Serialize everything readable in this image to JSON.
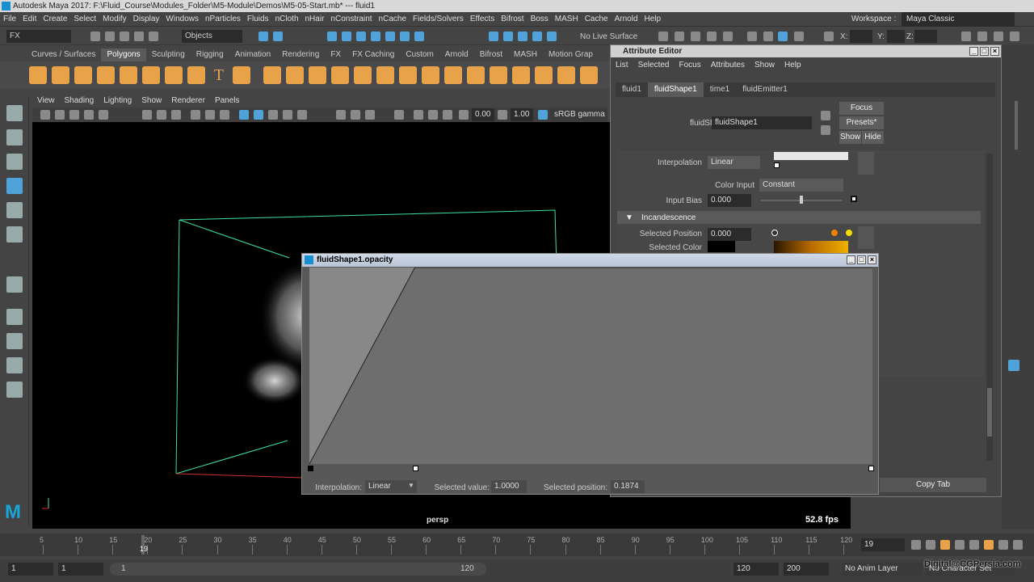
{
  "title": "Autodesk Maya 2017: F:\\Fluid_Course\\Modules_Folder\\M5-Module\\Demos\\M5-05-Start.mb*  ---  fluid1",
  "menubar": [
    "File",
    "Edit",
    "Create",
    "Select",
    "Modify",
    "Display",
    "Windows",
    "nParticles",
    "Fluids",
    "nCloth",
    "nHair",
    "nConstraint",
    "nCache",
    "Fields/Solvers",
    "Effects",
    "Bifrost",
    "Boss",
    "MASH",
    "Cache",
    "Arnold",
    "Help"
  ],
  "workspace": {
    "label": "Workspace :",
    "value": "Maya Classic"
  },
  "statusline": {
    "mode": "FX",
    "objects": "Objects",
    "live_surface": "No Live Surface",
    "x_label": "X:",
    "y_label": "Y:",
    "z_label": "Z:"
  },
  "shelf_tabs": [
    "Curves / Surfaces",
    "Polygons",
    "Sculpting",
    "Rigging",
    "Animation",
    "Rendering",
    "FX",
    "FX Caching",
    "Custom",
    "Arnold",
    "Bifrost",
    "MASH",
    "Motion Grap"
  ],
  "shelf_active": "Polygons",
  "viewport": {
    "menu": [
      "View",
      "Shading",
      "Lighting",
      "Show",
      "Renderer",
      "Panels"
    ],
    "exposure": "0.00",
    "gamma": "1.00",
    "color_space": "sRGB gamma",
    "camera": "persp",
    "fps": "52.8 fps"
  },
  "attribute_editor": {
    "title": "Attribute Editor",
    "menu": [
      "List",
      "Selected",
      "Focus",
      "Attributes",
      "Show",
      "Help"
    ],
    "tabs": [
      "fluid1",
      "fluidShape1",
      "time1",
      "fluidEmitter1"
    ],
    "active_tab": "fluidShape1",
    "shape_label": "fluidShape:",
    "shape_value": "fluidShape1",
    "focus_btn": "Focus",
    "presets_btn": "Presets*",
    "show_btn": "Show",
    "hide_btn": "Hide",
    "interpolation_label": "Interpolation",
    "interpolation_value": "Linear",
    "color_input_label": "Color Input",
    "color_input_value": "Constant",
    "input_bias_label": "Input Bias",
    "input_bias_value": "0.000",
    "incandescence_header": "Incandescence",
    "selected_position_label": "Selected Position",
    "selected_position_value": "0.000",
    "selected_color_label": "Selected Color",
    "copy_tab": "Copy Tab"
  },
  "ramp_window": {
    "title": "fluidShape1.opacity",
    "interpolation_label": "Interpolation:",
    "interpolation_value": "Linear",
    "selected_value_label": "Selected value:",
    "selected_value": "1.0000",
    "selected_position_label": "Selected position:",
    "selected_position": "0.1874",
    "ramp_points": [
      {
        "position": 0.0,
        "value": 0.0
      },
      {
        "position": 0.1874,
        "value": 1.0
      },
      {
        "position": 1.0,
        "value": 1.0
      }
    ]
  },
  "timeline": {
    "ticks": [
      "5",
      "10",
      "15",
      "20",
      "25",
      "30",
      "35",
      "40",
      "45",
      "50",
      "55",
      "60",
      "65",
      "70",
      "75",
      "80",
      "85",
      "90",
      "95",
      "100",
      "105",
      "110",
      "115",
      "120"
    ],
    "current_frame_marker": "19",
    "current_frame": "19"
  },
  "range": {
    "start": "1",
    "playback_start": "1",
    "slider_start": "1",
    "slider_end": "120",
    "playback_end": "120",
    "end": "200",
    "anim_layer": "No Anim Layer",
    "char_set": "No Character Set"
  },
  "watermark": "Digital@CGPersia.com"
}
